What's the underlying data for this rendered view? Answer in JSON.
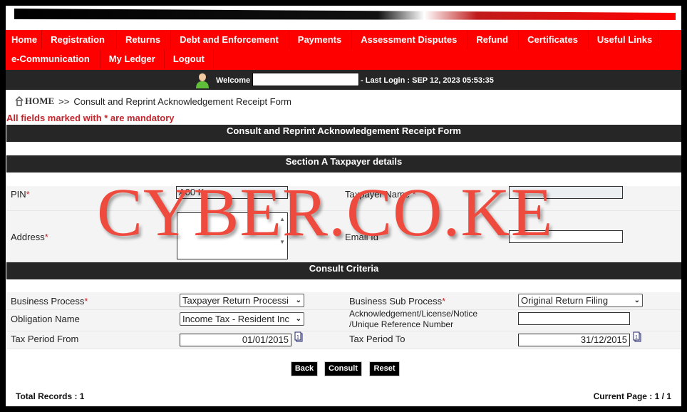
{
  "nav": {
    "row1": [
      "Home",
      "Registration",
      "Returns",
      "Debt and Enforcement",
      "Payments",
      "Assessment Disputes",
      "Refund",
      "Certificates",
      "Useful Links"
    ],
    "row2": [
      "e-Communication",
      "My Ledger",
      "Logout"
    ]
  },
  "welcome": {
    "greeting": "Welcome",
    "last_login": "- Last Login : SEP 12, 2023 05:53:35"
  },
  "breadcrumb": {
    "home": "HOME",
    "separator": ">>",
    "current": "Consult and Reprint Acknowledgement Receipt Form"
  },
  "mandatory_note": "All fields marked with * are mandatory",
  "form_title": "Consult and Reprint Acknowledgement Receipt Form",
  "section_a": {
    "title": "Section A Taxpayer details",
    "pin_label": "PIN",
    "pin_value": "A00          K",
    "taxpayer_name_label": "Taxpayer Name",
    "taxpayer_name_value": "",
    "address_label": "Address",
    "email_label": "Email Id",
    "email_value": ""
  },
  "consult_criteria": {
    "title": "Consult Criteria",
    "business_process_label": "Business Process",
    "business_process_value": "Taxpayer Return Processi",
    "business_sub_process_label": "Business Sub Process",
    "business_sub_process_value": "Original Return Filing",
    "obligation_label": "Obligation Name",
    "obligation_value": "Income Tax - Resident Inc",
    "ack_label_line1": "Acknowledgement/License/Notice",
    "ack_label_line2": "/Unique Reference Number",
    "ack_value": "",
    "tax_from_label": "Tax Period From",
    "tax_from_value": "01/01/2015",
    "tax_to_label": "Tax Period To",
    "tax_to_value": "31/12/2015",
    "required_mark": "*"
  },
  "buttons": {
    "back": "Back",
    "consult": "Consult",
    "reset": "Reset"
  },
  "footer": {
    "total_records": "Total Records : 1",
    "current_page": "Current Page : 1 / 1"
  },
  "watermark": "CYBER.CO.KE",
  "colors": {
    "nav_red": "#ff0000",
    "dark_bar": "#262626",
    "mandatory_red": "#c0272d",
    "watermark": "#ef4a3e"
  }
}
